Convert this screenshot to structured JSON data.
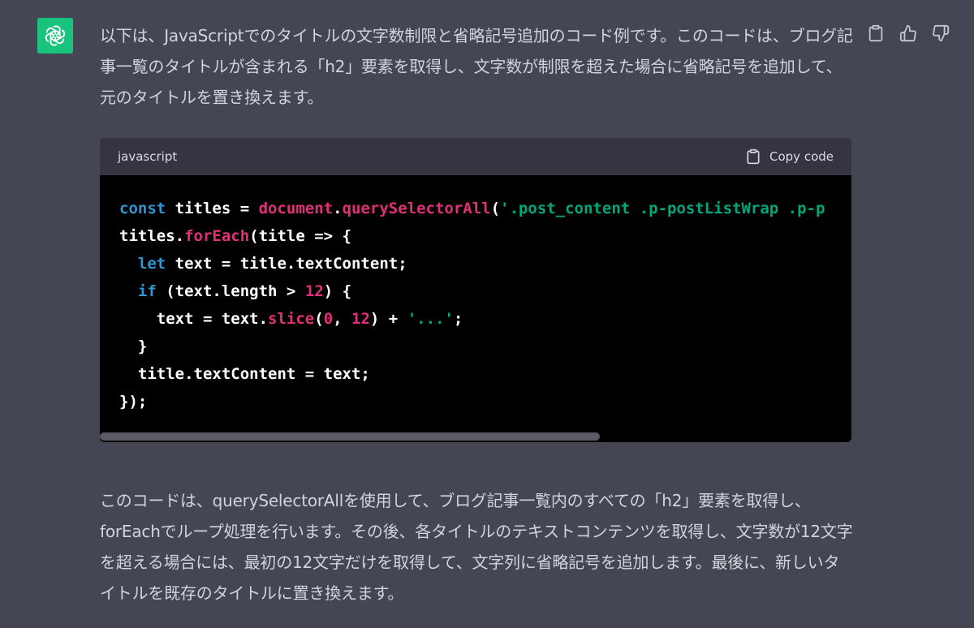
{
  "message": {
    "intro": "以下は、JavaScriptでのタイトルの文字数制限と省略記号追加のコード例です。このコードは、ブログ記事一覧のタイトルが含まれる「h2」要素を取得し、文字数が制限を超えた場合に省略記号を追加して、元のタイトルを置き換えます。",
    "outro": "このコードは、querySelectorAllを使用して、ブログ記事一覧内のすべての「h2」要素を取得し、forEachでループ処理を行います。その後、各タイトルのテキストコンテンツを取得し、文字数が12文字を超える場合には、最初の12文字だけを取得して、文字列に省略記号を追加します。最後に、新しいタイトルを既存のタイトルに置き換えます。"
  },
  "code_block": {
    "language": "javascript",
    "copy_label": "Copy code",
    "scroll_position": 0.0,
    "scroll_visible_fraction": 0.665
  },
  "code": {
    "l1_kw": "const",
    "l1_a": " titles = ",
    "l1_obj": "document",
    "l1_dot": ".",
    "l1_fn": "querySelectorAll",
    "l1_paren": "(",
    "l1_str": "'.post_content .p-postListWrap .p-p",
    "l2_a": "titles.",
    "l2_fn": "forEach",
    "l2_b": "(title => {",
    "l3_indent": "  ",
    "l3_kw": "let",
    "l3_a": " text = title.textContent;",
    "l4_indent": "  ",
    "l4_kw": "if",
    "l4_a": " (text.length > ",
    "l4_num": "12",
    "l4_b": ") {",
    "l5_a": "    text = text.",
    "l5_fn": "slice",
    "l5_b": "(",
    "l5_num1": "0",
    "l5_c": ", ",
    "l5_num2": "12",
    "l5_d": ") + ",
    "l5_str": "'...'",
    "l5_e": ";",
    "l6": "  }",
    "l7": "  title.textContent = text;",
    "l8": "});"
  },
  "icons": {
    "avatar": "openai-logo-icon",
    "copy": "clipboard-icon",
    "like": "thumbs-up-icon",
    "dislike": "thumbs-down-icon"
  },
  "colors": {
    "background": "#444654",
    "avatar_bg": "#19c37d",
    "code_bg": "#000000",
    "code_header_bg": "#343541",
    "keyword": "#2e95d3",
    "function": "#df3079",
    "string": "#00a67d",
    "number": "#df3079"
  }
}
